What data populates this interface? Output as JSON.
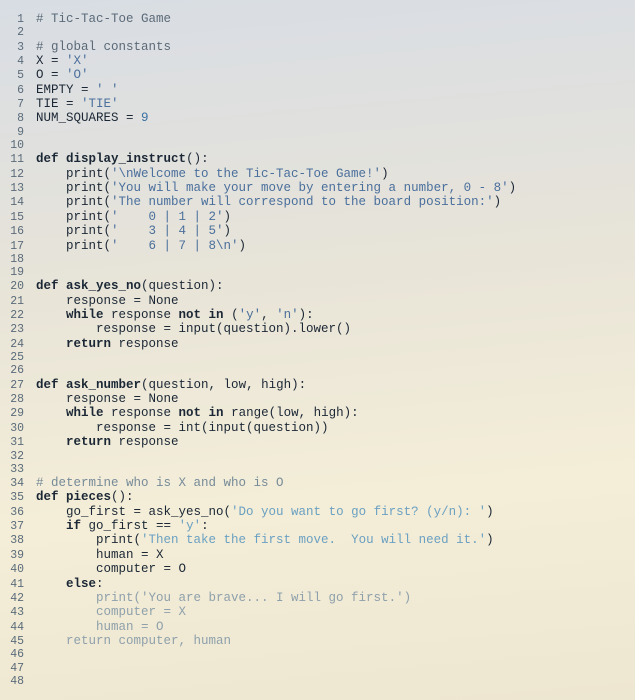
{
  "lines": [
    {
      "n": "1",
      "html": "<span class='comment'># Tic-Tac-Toe Game</span>"
    },
    {
      "n": "2",
      "html": ""
    },
    {
      "n": "3",
      "html": "<span class='comment'># global constants</span>"
    },
    {
      "n": "4",
      "html": "X = <span class='string'>'X'</span>"
    },
    {
      "n": "5",
      "html": "O = <span class='string'>'O'</span>"
    },
    {
      "n": "6",
      "html": "EMPTY = <span class='string'>' '</span>"
    },
    {
      "n": "7",
      "html": "TIE = <span class='string'>'TIE'</span>"
    },
    {
      "n": "8",
      "html": "NUM_SQUARES = <span class='num'>9</span>"
    },
    {
      "n": "9",
      "html": ""
    },
    {
      "n": "10",
      "html": ""
    },
    {
      "n": "11",
      "html": "<span class='keyword'>def</span> <span class='func'>display_instruct</span>():"
    },
    {
      "n": "12",
      "html": "    print(<span class='string'>'\\nWelcome to the Tic-Tac-Toe Game!'</span>)"
    },
    {
      "n": "13",
      "html": "    print(<span class='string'>'You will make your move by entering a number, 0 - 8'</span>)"
    },
    {
      "n": "14",
      "html": "    print(<span class='string'>'The number will correspond to the board position:'</span>)"
    },
    {
      "n": "15",
      "html": "    print(<span class='string'>'    0 | 1 | 2'</span>)"
    },
    {
      "n": "16",
      "html": "    print(<span class='string'>'    3 | 4 | 5'</span>)"
    },
    {
      "n": "17",
      "html": "    print(<span class='string'>'    6 | 7 | 8\\n'</span>)"
    },
    {
      "n": "18",
      "html": ""
    },
    {
      "n": "19",
      "html": ""
    },
    {
      "n": "20",
      "html": "<span class='keyword'>def</span> <span class='func'>ask_yes_no</span>(question):"
    },
    {
      "n": "21",
      "html": "    response = None"
    },
    {
      "n": "22",
      "html": "    <span class='keyword'>while</span> response <span class='keyword'>not in</span> (<span class='string'>'y'</span>, <span class='string'>'n'</span>):"
    },
    {
      "n": "23",
      "html": "        response = input(question).lower()"
    },
    {
      "n": "24",
      "html": "    <span class='keyword'>return</span> response"
    },
    {
      "n": "25",
      "html": ""
    },
    {
      "n": "26",
      "html": ""
    },
    {
      "n": "27",
      "html": "<span class='keyword'>def</span> <span class='func'>ask_number</span>(question, low, high):"
    },
    {
      "n": "28",
      "html": "    response = None"
    },
    {
      "n": "29",
      "html": "    <span class='keyword'>while</span> response <span class='keyword'>not in</span> range(low, high):"
    },
    {
      "n": "30",
      "html": "        response = int(input(question))"
    },
    {
      "n": "31",
      "html": "    <span class='keyword'>return</span> response"
    },
    {
      "n": "32",
      "html": ""
    },
    {
      "n": "33",
      "html": ""
    },
    {
      "n": "34",
      "html": "<span class='faded'># determine who is X and who is O</span>"
    },
    {
      "n": "35",
      "html": "<span class='keyword'>def</span> <span class='func'>pieces</span>():"
    },
    {
      "n": "36",
      "html": "    go_first = ask_yes_no(<span class='stringg'>'Do you want to go first? (y/n): '</span>)"
    },
    {
      "n": "37",
      "html": "    <span class='keyword'>if</span> go_first == <span class='stringg'>'y'</span>:"
    },
    {
      "n": "38",
      "html": "        print(<span class='stringg'>'Then take the first move.  You will need it.'</span>)"
    },
    {
      "n": "39",
      "html": "        human = X"
    },
    {
      "n": "40",
      "html": "        computer = O"
    },
    {
      "n": "41",
      "html": "    <span class='keyword'>else</span>:"
    },
    {
      "n": "42",
      "html": "        <span class='faded2'>print('You are brave... I will go first.')</span>"
    },
    {
      "n": "43",
      "html": "        <span class='faded2'>computer = X</span>"
    },
    {
      "n": "44",
      "html": "        <span class='faded2'>human = O</span>"
    },
    {
      "n": "45",
      "html": "    <span class='faded2'>return computer, human</span>"
    },
    {
      "n": "46",
      "html": ""
    },
    {
      "n": "47",
      "html": ""
    },
    {
      "n": "48",
      "html": ""
    }
  ]
}
